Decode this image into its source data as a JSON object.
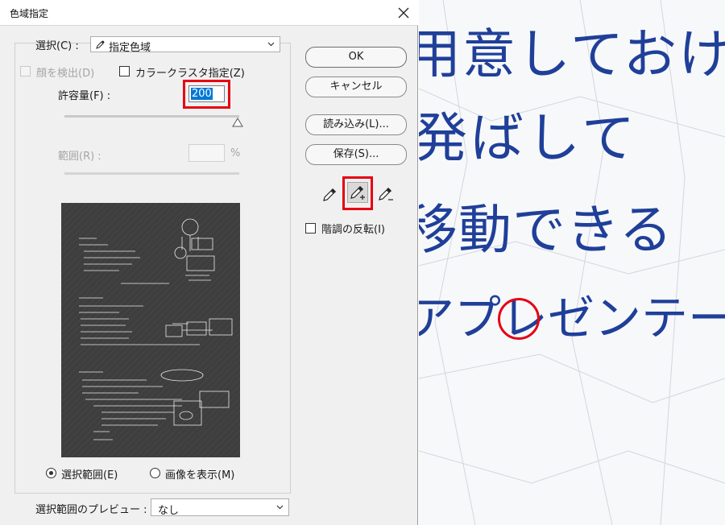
{
  "dialog": {
    "title": "色域指定",
    "select": {
      "label": "選択(C) :",
      "value": "指定色域"
    },
    "detect_faces": "顔を検出(D)",
    "localized_color_clusters": "カラークラスタ指定(Z)",
    "fuzziness": {
      "label": "許容量(F) :",
      "value": "200"
    },
    "range": {
      "label": "範囲(R) :",
      "value": "",
      "unit": "%"
    },
    "preview_mode": {
      "selection": "選択範囲(E)",
      "image": "画像を表示(M)",
      "selected": "selection"
    },
    "selection_preview": {
      "label": "選択範囲のプレビュー :",
      "value": "なし"
    },
    "buttons": {
      "ok": "OK",
      "cancel": "キャンセル",
      "load": "読み込み(L)...",
      "save": "保存(S)..."
    },
    "tools": {
      "eyedropper": "eyedropper-icon",
      "add_to_sample": "eyedropper-plus-icon",
      "subtract_from_sample": "eyedropper-minus-icon",
      "active": "add_to_sample"
    },
    "invert": "階調の反転(I)"
  },
  "photo": {
    "lines": [
      "用意しておけ",
      "発ばして",
      "移動できる",
      "アプレゼンテー"
    ]
  },
  "colors": {
    "highlight": "#e60012",
    "ink": "#1f3f99",
    "selection": "#0078d7"
  }
}
